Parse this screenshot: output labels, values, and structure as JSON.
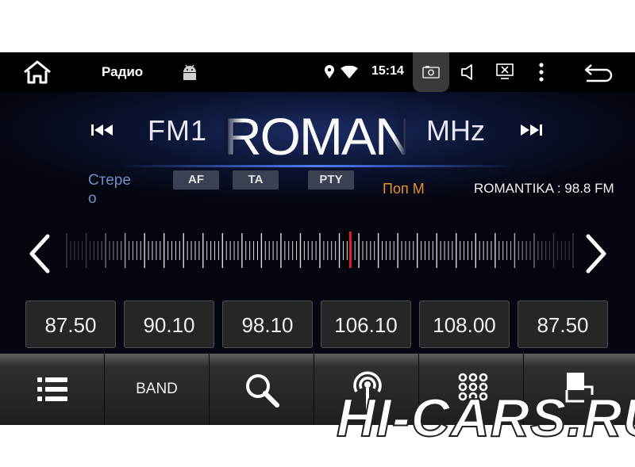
{
  "status_bar": {
    "app_title": "Радио",
    "time": "15:14",
    "icons": [
      "home-icon",
      "android-icon",
      "location-icon",
      "wifi-icon",
      "screenshot-icon",
      "volume-icon",
      "screen-off-icon",
      "more-icon",
      "back-icon"
    ]
  },
  "radio": {
    "band": "FM1",
    "station_name_scrolling": "ROMAN",
    "unit": "MHz",
    "stereo": "Стерео",
    "flags": {
      "af": "AF",
      "ta": "TA",
      "pty": "PTY"
    },
    "genre": "Поп М",
    "rds_text": "ROMANTIKA : 98.8 FM",
    "current_frequency_fraction": 0.56
  },
  "presets": [
    "87.50",
    "90.10",
    "98.10",
    "106.10",
    "108.00",
    "87.50"
  ],
  "toolbar": {
    "band_label": "BAND",
    "icons": [
      "list-icon",
      "search-icon",
      "antenna-icon",
      "keypad-icon",
      "exit-icon"
    ]
  },
  "watermark": "HI-CARS.RU",
  "colors": {
    "needle": "#e0202a",
    "genre": "#e3922e",
    "stereo": "#6f8fc6",
    "accent_glow": "#4e7dff"
  }
}
